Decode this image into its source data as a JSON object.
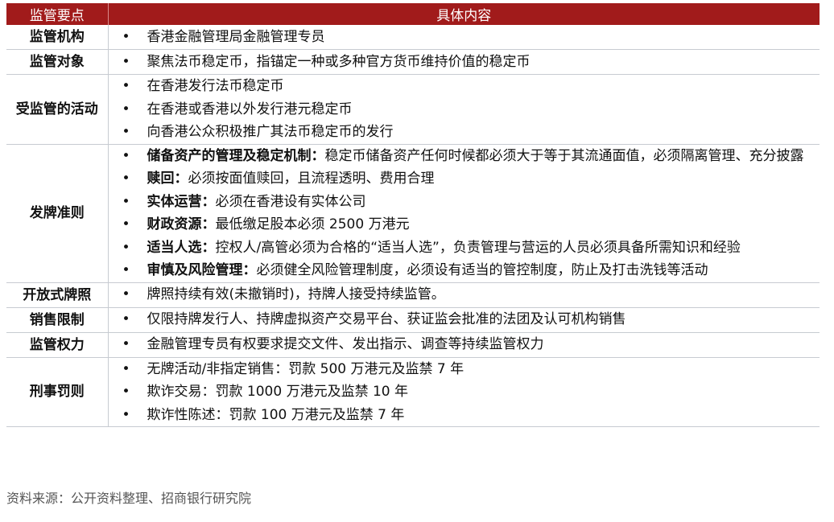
{
  "table": {
    "header": {
      "col1": "监管要点",
      "col2": "具体内容"
    },
    "bullet": "•",
    "rows": [
      {
        "key": "监管机构",
        "items": [
          {
            "bold": "",
            "text": "香港金融管理局金融管理专员"
          }
        ]
      },
      {
        "key": "监管对象",
        "items": [
          {
            "bold": "",
            "text": "聚焦法币稳定币，指锚定一种或多种官方货币维持价值的稳定币"
          }
        ]
      },
      {
        "key": "受监管的活动",
        "items": [
          {
            "bold": "",
            "text": "在香港发行法币稳定币"
          },
          {
            "bold": "",
            "text": "在香港或香港以外发行港元稳定币"
          },
          {
            "bold": "",
            "text": "向香港公众积极推广其法币稳定币的发行"
          }
        ]
      },
      {
        "key": "发牌准则",
        "items": [
          {
            "bold": "储备资产的管理及稳定机制：",
            "text": "稳定币储备资产任何时候都必须大于等于其流通面值，必须隔离管理、充分披露"
          },
          {
            "bold": "赎回：",
            "text": "必须按面值赎回，且流程透明、费用合理"
          },
          {
            "bold": "实体运营：",
            "text": "必须在香港设有实体公司"
          },
          {
            "bold": "财政资源：",
            "text": "最低缴足股本必须 2500 万港元"
          },
          {
            "bold": "适当人选：",
            "text": "控权人/高管必须为合格的“适当人选”，负责管理与营运的人员必须具备所需知识和经验"
          },
          {
            "bold": "审慎及风险管理：",
            "text": "必须健全风险管理制度，必须设有适当的管控制度，防止及打击洗钱等活动"
          }
        ]
      },
      {
        "key": "开放式牌照",
        "items": [
          {
            "bold": "",
            "text": "牌照持续有效(未撤销时)，持牌人接受持续监管。"
          }
        ]
      },
      {
        "key": "销售限制",
        "items": [
          {
            "bold": "",
            "text": "仅限持牌发行人、持牌虚拟资产交易平台、获证监会批准的法团及认可机构销售"
          }
        ]
      },
      {
        "key": "监管权力",
        "items": [
          {
            "bold": "",
            "text": "金融管理专员有权要求提交文件、发出指示、调查等持续监管权力"
          }
        ]
      },
      {
        "key": "刑事罚则",
        "items": [
          {
            "bold": "",
            "text": "无牌活动/非指定销售：罚款 500 万港元及监禁 7 年"
          },
          {
            "bold": "",
            "text": "欺诈交易：罚款 1000 万港元及监禁 10 年"
          },
          {
            "bold": "",
            "text": "欺诈性陈述：罚款 100 万港元及监禁 7 年"
          }
        ]
      }
    ]
  },
  "source": "资料来源：公开资料整理、招商银行研究院",
  "colors": {
    "header_bg": "#a11b1b",
    "header_text": "#ffffff",
    "grid": "#c7cbd1"
  }
}
